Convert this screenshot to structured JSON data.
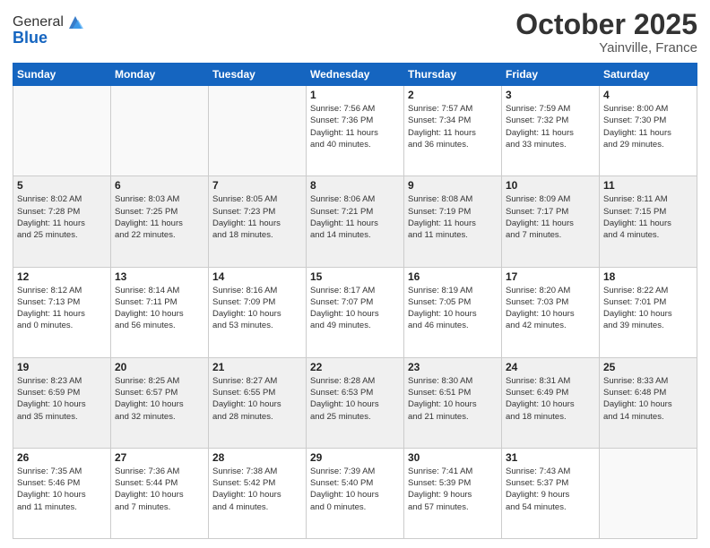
{
  "header": {
    "logo_general": "General",
    "logo_blue": "Blue",
    "month": "October 2025",
    "location": "Yainville, France"
  },
  "days_of_week": [
    "Sunday",
    "Monday",
    "Tuesday",
    "Wednesday",
    "Thursday",
    "Friday",
    "Saturday"
  ],
  "weeks": [
    [
      {
        "day": "",
        "info": ""
      },
      {
        "day": "",
        "info": ""
      },
      {
        "day": "",
        "info": ""
      },
      {
        "day": "1",
        "info": "Sunrise: 7:56 AM\nSunset: 7:36 PM\nDaylight: 11 hours\nand 40 minutes."
      },
      {
        "day": "2",
        "info": "Sunrise: 7:57 AM\nSunset: 7:34 PM\nDaylight: 11 hours\nand 36 minutes."
      },
      {
        "day": "3",
        "info": "Sunrise: 7:59 AM\nSunset: 7:32 PM\nDaylight: 11 hours\nand 33 minutes."
      },
      {
        "day": "4",
        "info": "Sunrise: 8:00 AM\nSunset: 7:30 PM\nDaylight: 11 hours\nand 29 minutes."
      }
    ],
    [
      {
        "day": "5",
        "info": "Sunrise: 8:02 AM\nSunset: 7:28 PM\nDaylight: 11 hours\nand 25 minutes."
      },
      {
        "day": "6",
        "info": "Sunrise: 8:03 AM\nSunset: 7:25 PM\nDaylight: 11 hours\nand 22 minutes."
      },
      {
        "day": "7",
        "info": "Sunrise: 8:05 AM\nSunset: 7:23 PM\nDaylight: 11 hours\nand 18 minutes."
      },
      {
        "day": "8",
        "info": "Sunrise: 8:06 AM\nSunset: 7:21 PM\nDaylight: 11 hours\nand 14 minutes."
      },
      {
        "day": "9",
        "info": "Sunrise: 8:08 AM\nSunset: 7:19 PM\nDaylight: 11 hours\nand 11 minutes."
      },
      {
        "day": "10",
        "info": "Sunrise: 8:09 AM\nSunset: 7:17 PM\nDaylight: 11 hours\nand 7 minutes."
      },
      {
        "day": "11",
        "info": "Sunrise: 8:11 AM\nSunset: 7:15 PM\nDaylight: 11 hours\nand 4 minutes."
      }
    ],
    [
      {
        "day": "12",
        "info": "Sunrise: 8:12 AM\nSunset: 7:13 PM\nDaylight: 11 hours\nand 0 minutes."
      },
      {
        "day": "13",
        "info": "Sunrise: 8:14 AM\nSunset: 7:11 PM\nDaylight: 10 hours\nand 56 minutes."
      },
      {
        "day": "14",
        "info": "Sunrise: 8:16 AM\nSunset: 7:09 PM\nDaylight: 10 hours\nand 53 minutes."
      },
      {
        "day": "15",
        "info": "Sunrise: 8:17 AM\nSunset: 7:07 PM\nDaylight: 10 hours\nand 49 minutes."
      },
      {
        "day": "16",
        "info": "Sunrise: 8:19 AM\nSunset: 7:05 PM\nDaylight: 10 hours\nand 46 minutes."
      },
      {
        "day": "17",
        "info": "Sunrise: 8:20 AM\nSunset: 7:03 PM\nDaylight: 10 hours\nand 42 minutes."
      },
      {
        "day": "18",
        "info": "Sunrise: 8:22 AM\nSunset: 7:01 PM\nDaylight: 10 hours\nand 39 minutes."
      }
    ],
    [
      {
        "day": "19",
        "info": "Sunrise: 8:23 AM\nSunset: 6:59 PM\nDaylight: 10 hours\nand 35 minutes."
      },
      {
        "day": "20",
        "info": "Sunrise: 8:25 AM\nSunset: 6:57 PM\nDaylight: 10 hours\nand 32 minutes."
      },
      {
        "day": "21",
        "info": "Sunrise: 8:27 AM\nSunset: 6:55 PM\nDaylight: 10 hours\nand 28 minutes."
      },
      {
        "day": "22",
        "info": "Sunrise: 8:28 AM\nSunset: 6:53 PM\nDaylight: 10 hours\nand 25 minutes."
      },
      {
        "day": "23",
        "info": "Sunrise: 8:30 AM\nSunset: 6:51 PM\nDaylight: 10 hours\nand 21 minutes."
      },
      {
        "day": "24",
        "info": "Sunrise: 8:31 AM\nSunset: 6:49 PM\nDaylight: 10 hours\nand 18 minutes."
      },
      {
        "day": "25",
        "info": "Sunrise: 8:33 AM\nSunset: 6:48 PM\nDaylight: 10 hours\nand 14 minutes."
      }
    ],
    [
      {
        "day": "26",
        "info": "Sunrise: 7:35 AM\nSunset: 5:46 PM\nDaylight: 10 hours\nand 11 minutes."
      },
      {
        "day": "27",
        "info": "Sunrise: 7:36 AM\nSunset: 5:44 PM\nDaylight: 10 hours\nand 7 minutes."
      },
      {
        "day": "28",
        "info": "Sunrise: 7:38 AM\nSunset: 5:42 PM\nDaylight: 10 hours\nand 4 minutes."
      },
      {
        "day": "29",
        "info": "Sunrise: 7:39 AM\nSunset: 5:40 PM\nDaylight: 10 hours\nand 0 minutes."
      },
      {
        "day": "30",
        "info": "Sunrise: 7:41 AM\nSunset: 5:39 PM\nDaylight: 9 hours\nand 57 minutes."
      },
      {
        "day": "31",
        "info": "Sunrise: 7:43 AM\nSunset: 5:37 PM\nDaylight: 9 hours\nand 54 minutes."
      },
      {
        "day": "",
        "info": ""
      }
    ]
  ]
}
